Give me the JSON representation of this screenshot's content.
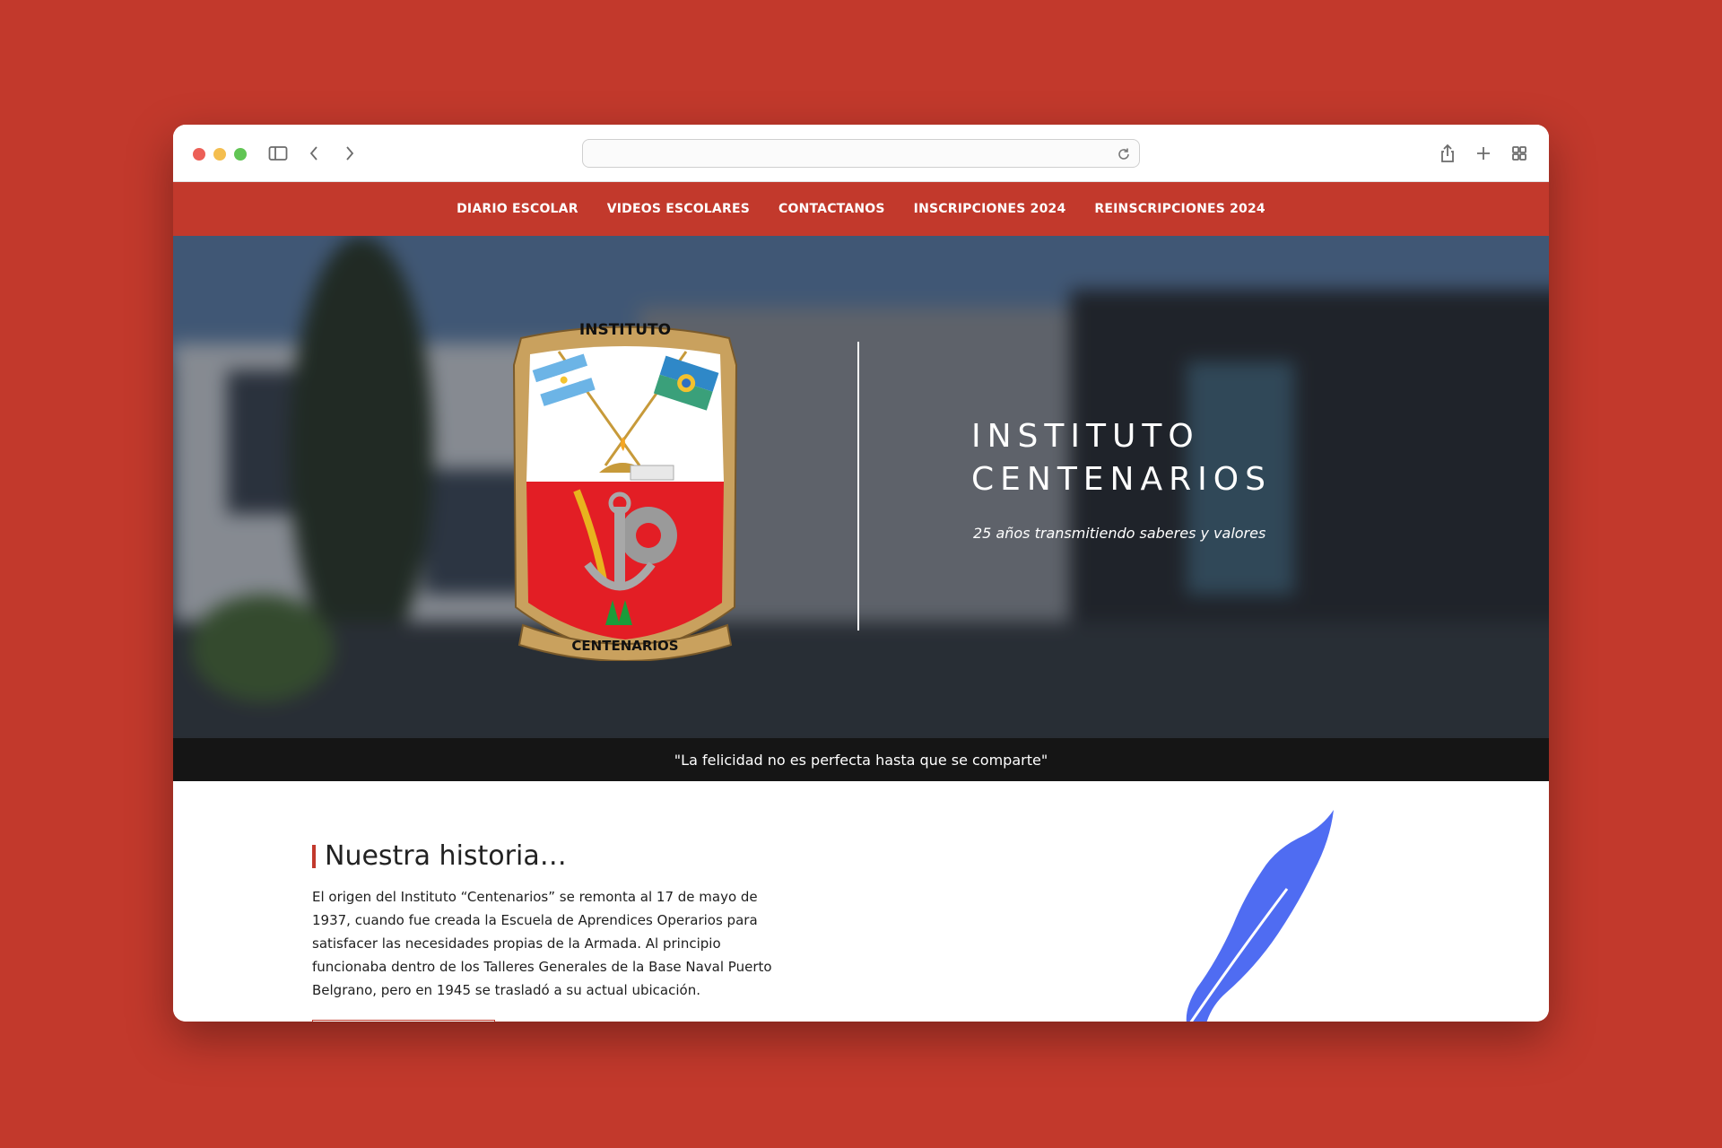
{
  "colors": {
    "brand_red": "#c2392c",
    "quote_bar": "#151515",
    "feather_blue": "#4f6cf2"
  },
  "browser": {
    "address_value": "",
    "icons": [
      "sidebar-icon",
      "back-icon",
      "forward-icon",
      "reload-icon",
      "share-icon",
      "new-tab-icon",
      "tab-overview-icon"
    ]
  },
  "nav": {
    "items": [
      {
        "label": "DIARIO ESCOLAR"
      },
      {
        "label": "VIDEOS ESCOLARES"
      },
      {
        "label": "CONTACTANOS"
      },
      {
        "label": "INSCRIPCIONES 2024"
      },
      {
        "label": "REINSCRIPCIONES 2024"
      }
    ]
  },
  "hero": {
    "crest_top": "INSTITUTO",
    "crest_bottom": "CENTENARIOS",
    "title_line1": "INSTITUTO",
    "title_line2": "CENTENARIOS",
    "subtitle": "25 años transmitiendo saberes y valores"
  },
  "quote": "\"La felicidad no es perfecta hasta que se comparte\"",
  "history": {
    "title": "Nuestra historia…",
    "text": "El origen del Instituto “Centenarios” se remonta al 17 de mayo de 1937, cuando fue creada la Escuela de Aprendices Operarios para satisfacer las necesidades propias de la Armada. Al principio funcionaba dentro de los Talleres Generales de la Base Naval Puerto Belgrano, pero en 1945 se trasladó a su actual ubicación."
  }
}
